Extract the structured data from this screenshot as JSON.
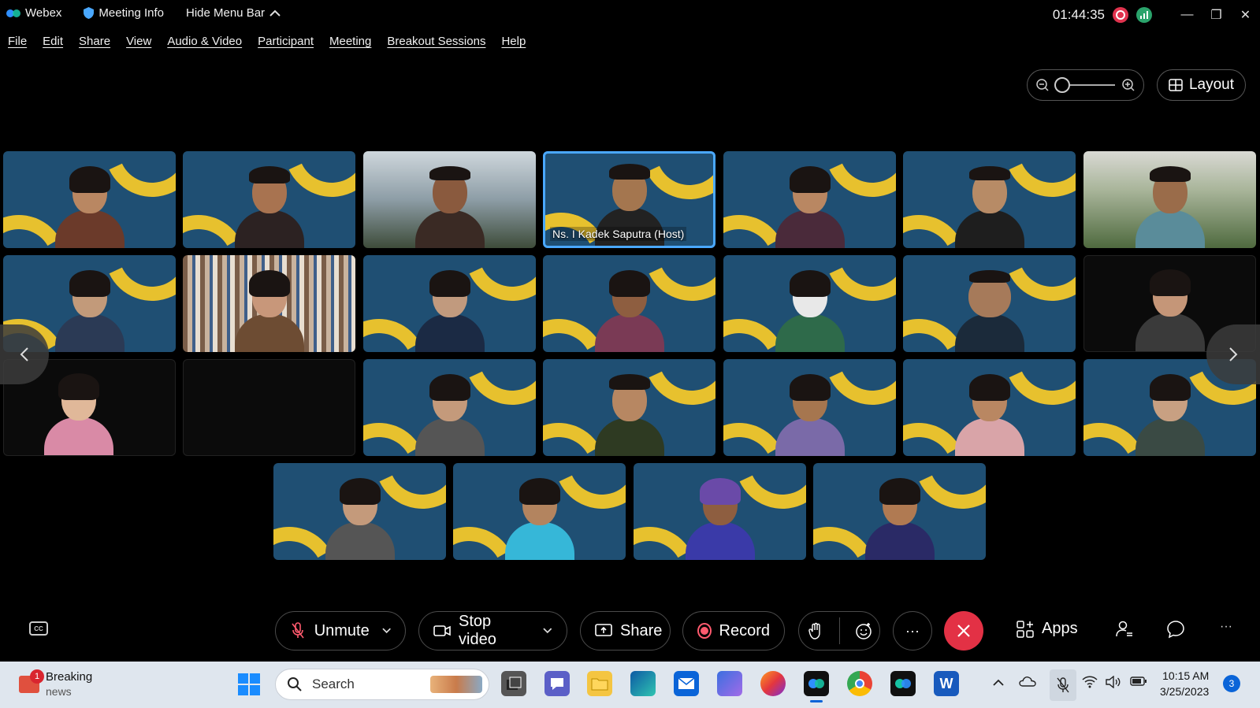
{
  "titlebar": {
    "app_name": "Webex",
    "meeting_info": "Meeting Info",
    "hide_menu": "Hide Menu Bar",
    "clock": "01:44:35"
  },
  "menu": [
    "File",
    "Edit",
    "Share",
    "View",
    "Audio & Video",
    "Participant",
    "Meeting",
    "Breakout Sessions",
    "Help"
  ],
  "layout_label": "Layout",
  "host_name": "Ns. I Kadek Saputra (Host)",
  "controls": {
    "unmute": "Unmute",
    "stop_video": "Stop video",
    "share": "Share",
    "record": "Record",
    "apps": "Apps",
    "more": "···",
    "cc": "CC"
  },
  "taskbar": {
    "news_title": "Breaking",
    "news_sub": "news",
    "news_badge": "1",
    "search_placeholder": "Search",
    "time": "10:15 AM",
    "date": "3/25/2023",
    "notifications": "3"
  },
  "colors": {
    "accent": "#4aa8ff",
    "end_call": "#e33145",
    "tile_bg": "#1f4f73",
    "tile_arc": "#e7c12e"
  }
}
